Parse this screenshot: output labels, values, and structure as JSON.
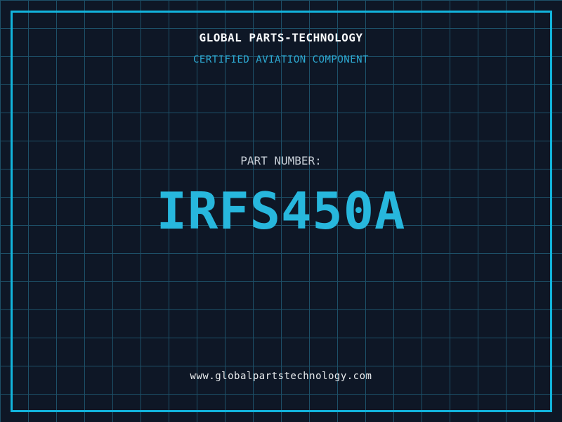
{
  "card": {
    "company": "GLOBAL PARTS-TECHNOLOGY",
    "certification": "CERTIFIED AVIATION COMPONENT",
    "part_label": "PART NUMBER:",
    "part_number": "IRFS450A",
    "website": "www.globalpartstechnology.com"
  },
  "colors": {
    "background": "#0e1726",
    "grid_line": "#1d5068",
    "frame": "#12b4dc",
    "title_text": "#f5f7f9",
    "subtitle_text": "#2da9d2",
    "label_text": "#c9d0d8",
    "part_number_text": "#27b7dd",
    "website_text": "#e9ecee"
  }
}
